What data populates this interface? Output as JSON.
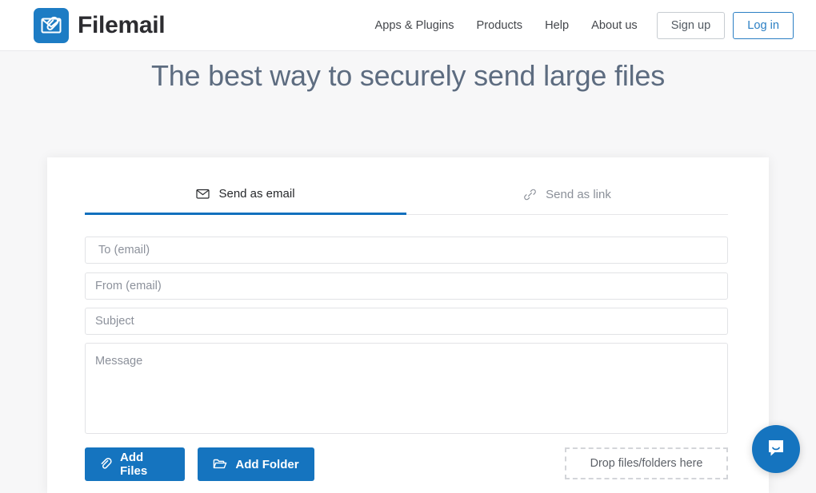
{
  "header": {
    "brand_name": "Filemail",
    "logo_icon": "envelope-paperclip-logo",
    "nav_links": [
      {
        "label": "Apps & Plugins"
      },
      {
        "label": "Products"
      },
      {
        "label": "Help"
      },
      {
        "label": "About us"
      }
    ],
    "signup_label": "Sign up",
    "login_label": "Log in",
    "accent_color": "#1574bf",
    "brand_color": "#1d7cc4"
  },
  "hero": {
    "headline": "The best way to securely send large files",
    "headline_color": "#5d6c80"
  },
  "form_card": {
    "tabs": [
      {
        "label": "Send as email",
        "icon": "envelope-icon",
        "active": true
      },
      {
        "label": "Send as link",
        "icon": "link-icon",
        "active": false
      }
    ],
    "fields": {
      "to": {
        "placeholder": "To (email)",
        "value": ""
      },
      "from": {
        "placeholder": "From (email)",
        "value": ""
      },
      "subject": {
        "placeholder": "Subject",
        "value": ""
      },
      "message": {
        "placeholder": "Message",
        "value": ""
      }
    },
    "buttons": {
      "add_files": {
        "label": "Add Files",
        "icon": "paperclip-icon"
      },
      "add_folder": {
        "label": "Add Folder",
        "icon": "folder-open-icon"
      }
    },
    "dropzone_label": "Drop files/folders here"
  },
  "chat": {
    "icon": "chat-bubble-smile-icon",
    "color": "#1574bf"
  }
}
